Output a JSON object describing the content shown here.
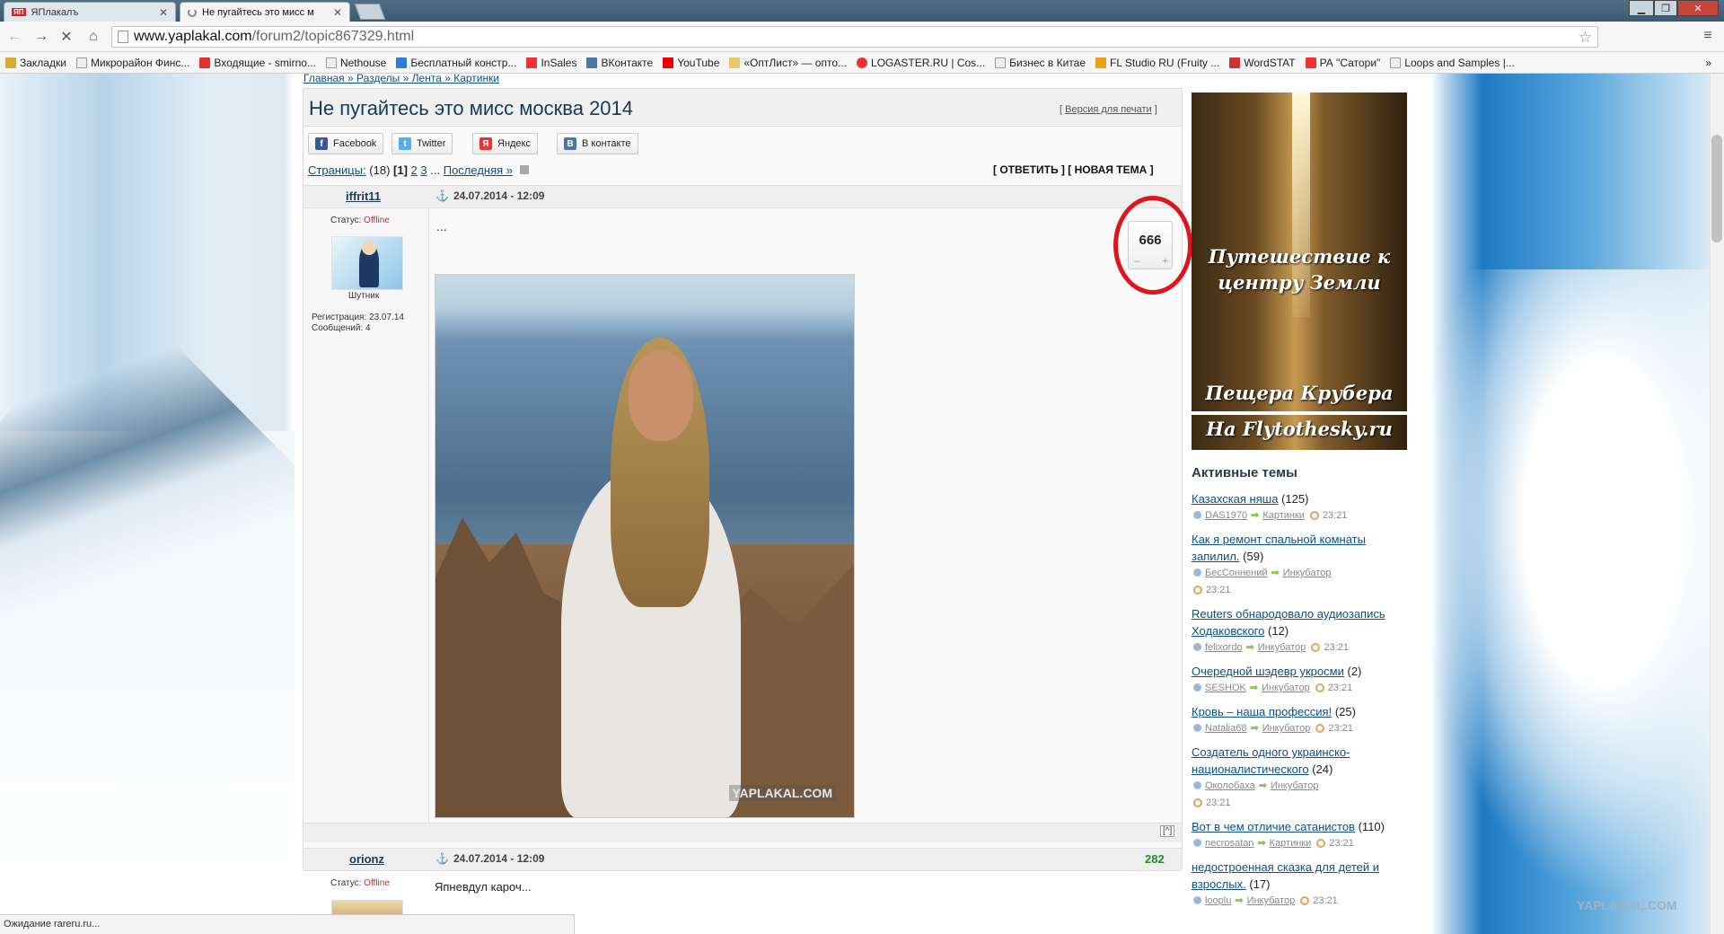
{
  "browser": {
    "tabs": [
      {
        "label": "ЯПлакалъ",
        "badge": "ЯП",
        "active": false
      },
      {
        "label": "Не пугайтесь это мисс м",
        "active": true
      }
    ],
    "url_host": "www.yaplakal.com",
    "url_path": "/forum2/topic867329.html",
    "status_text": "Ожидание rareru.ru...",
    "bookmarks": [
      {
        "label": "Закладки",
        "color": "#d9a93a"
      },
      {
        "label": "Микрорайон Финс...",
        "color": "#dddddd"
      },
      {
        "label": "Входящие - smirno...",
        "color": "#d33"
      },
      {
        "label": "Nethouse",
        "color": "#dddddd"
      },
      {
        "label": "Бесплатный констр...",
        "color": "#2a7fd4"
      },
      {
        "label": "InSales",
        "color": "#e33"
      },
      {
        "label": "ВКонтакте",
        "color": "#4a76a8"
      },
      {
        "label": "YouTube",
        "color": "#e00"
      },
      {
        "label": "«ОптЛист» — опто...",
        "color": "#e8c86a"
      },
      {
        "label": "LOGASTER.RU | Cos...",
        "color": "#e33"
      },
      {
        "label": "Бизнес в Китае",
        "color": "#dddddd"
      },
      {
        "label": "FL Studio RU (Fruity ...",
        "color": "#e8a21a"
      },
      {
        "label": "WordSTAT",
        "color": "#c33"
      },
      {
        "label": "РА \"Сатори\"",
        "color": "#e33"
      },
      {
        "label": "Loops and Samples |...",
        "color": "#dddddd"
      }
    ]
  },
  "page": {
    "breadcrumb": "Главная » Разделы » Лента » Картинки",
    "title": "Не пугайтесь это мисс москва 2014",
    "print_label": "Версия для печати",
    "share": [
      {
        "label": "Facebook",
        "icon": "f",
        "color": "#3b5998"
      },
      {
        "label": "Twitter",
        "icon": "t",
        "color": "#55acee"
      },
      {
        "label": "Яндекс",
        "icon": "Я",
        "color": "#e33"
      },
      {
        "label": "В контакте",
        "icon": "B",
        "color": "#4a76a8"
      }
    ],
    "pages_label": "Страницы:",
    "pages_count": "(18)",
    "page_current": "[1]",
    "page_2": "2",
    "page_3": "3",
    "ellipsis": "...",
    "page_last": "Последняя »",
    "reply_label": "[ ОТВЕТИТЬ ] [ НОВАЯ ТЕМА ]",
    "post1": {
      "author": "iffrit11",
      "date": "24.07.2014 - 12:09",
      "status_label": "Статус:",
      "status_value": "Offline",
      "rank": "Шутник",
      "registration": "Регистрация: 23.07.14",
      "messages": "Сообщений: 4",
      "text": "...",
      "rating": "666",
      "minus": "–",
      "plus": "+",
      "watermark": "YAPLAKAL.COM",
      "to_top": "[^]"
    },
    "post2": {
      "author": "orionz",
      "date": "24.07.2014 - 12:09",
      "status_label": "Статус:",
      "status_value": "Offline",
      "text": "Япневдул кароч...",
      "rating": "282"
    }
  },
  "ad": {
    "line1": "Путешествие к центру Земли",
    "line2": "Пещера Крубера",
    "line3": "На Flytothesky.ru"
  },
  "active_topics": {
    "title": "Активные темы",
    "items": [
      {
        "title": "Казахская няша",
        "count": "(125)",
        "user": "DAS1970",
        "section": "Картинки",
        "time": "23:21"
      },
      {
        "title": "Как я ремонт спальной комнаты запилил.",
        "count": "(59)",
        "user": "БесСоннений",
        "section": "Инкубатор",
        "time": "23:21"
      },
      {
        "title": "Reuters обнародовало аудиозапись Ходаковского",
        "count": "(12)",
        "user": "felixordo",
        "section": "Инкубатор",
        "time": "23:21"
      },
      {
        "title": "Очередной шэдевр укросми",
        "count": "(2)",
        "user": "SESHOK",
        "section": "Инкубатор",
        "time": "23:21"
      },
      {
        "title": "Кровь – наша профессия!",
        "count": "(25)",
        "user": "Natalia68",
        "section": "Инкубатор",
        "time": "23:21"
      },
      {
        "title": "Создатель одного украинско-националистического",
        "count": "(24)",
        "user": "Околобаха",
        "section": "Инкубатор",
        "time": "23:21"
      },
      {
        "title": "Вот в чем отличие сатанистов",
        "count": "(110)",
        "user": "necrosatan",
        "section": "Картинки",
        "time": "23:21"
      },
      {
        "title": "недостроенная сказка для детей и взрослых.",
        "count": "(17)",
        "user": "looplu",
        "section": "Инкубатор",
        "time": "23:21"
      }
    ]
  },
  "site_watermark": "YAPLAKAL.COM",
  "colors": {
    "highlight_ring": "#e0141c",
    "link": "#0b4f8a",
    "positive": "#1e8c2c"
  }
}
